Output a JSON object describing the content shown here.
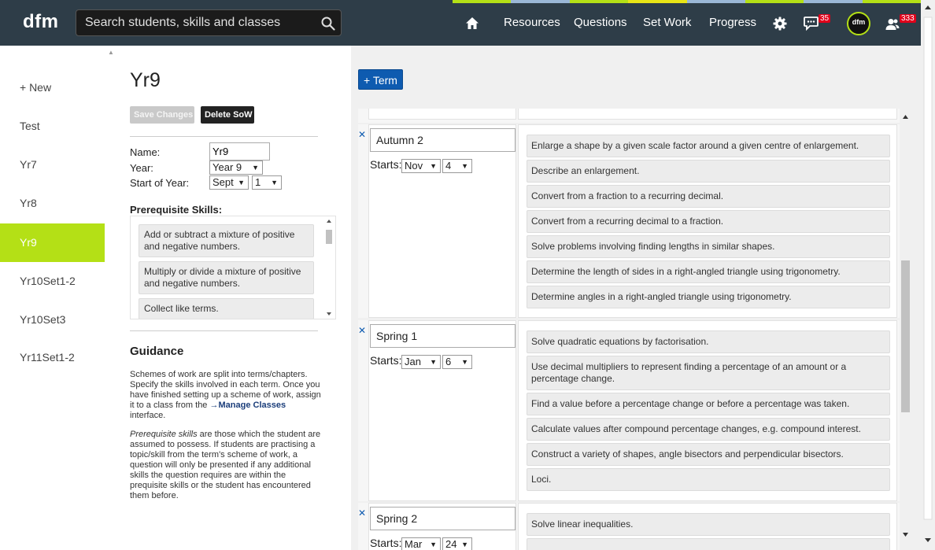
{
  "header": {
    "logo": "dfm",
    "search_placeholder": "Search students, skills and classes",
    "nav": [
      "Resources",
      "Questions",
      "Set Work",
      "Progress"
    ],
    "messages_badge": "35",
    "notifications_badge": "333",
    "avatar_text": "dfm",
    "strip_colors": [
      "#b4e016",
      "#9ab7d6",
      "#b4e016",
      "#e8e516",
      "#9ab7d6",
      "#b4e016",
      "#9ab7d6",
      "#b4e016"
    ]
  },
  "sidebar": {
    "items": [
      "+ New",
      "Test",
      "Yr7",
      "Yr8",
      "Yr9",
      "Yr10Set1-2",
      "Yr10Set3",
      "Yr11Set1-2"
    ],
    "active_index": 4
  },
  "sow": {
    "title": "Yr9",
    "save_label": "Save Changes",
    "delete_label": "Delete SoW",
    "name_label": "Name:",
    "name_value": "Yr9",
    "year_label": "Year:",
    "year_value": "Year 9",
    "start_label": "Start of Year:",
    "start_month": "Sept",
    "start_day": "1",
    "prereq_label": "Prerequisite Skills:",
    "prereq_items": [
      "Add or subtract a mixture of positive and negative numbers.",
      "Multiply or divide a mixture of positive and negative numbers.",
      "Collect like terms."
    ]
  },
  "guidance": {
    "title": "Guidance",
    "p1_before": "Schemes of work are split into terms/chapters. Specify the skills involved in each term. Once you have finished setting up a scheme of work, assign it to a class from the ",
    "p1_link": "→Manage Classes",
    "p1_after": " interface.",
    "p2_em": "Prerequisite skills",
    "p2_rest": " are those which the student are assumed to possess. If students are practising a topic/skill from the term's scheme of work, a question will only be presented if any additional skills the question requires are within the prequisite skills or the student has encountered them before."
  },
  "terms_panel": {
    "add_term_label": "+ Term",
    "starts_label": "Starts:",
    "terms": [
      {
        "name": "Autumn 2",
        "month": "Nov",
        "day": "4",
        "skills": [
          "Enlarge a shape by a given scale factor around a given centre of enlargement.",
          "Describe an enlargement.",
          "Convert from a fraction to a recurring decimal.",
          "Convert from a recurring decimal to a fraction.",
          "Solve problems involving finding lengths in similar shapes.",
          "Determine the length of sides in a right-angled triangle using trigonometry.",
          "Determine angles in a right-angled triangle using trigonometry."
        ]
      },
      {
        "name": "Spring 1",
        "month": "Jan",
        "day": "6",
        "skills": [
          "Solve quadratic equations by factorisation.",
          "Use decimal multipliers to represent finding a percentage of an amount or a percentage change.",
          "Find a value before a percentage change or before a percentage was taken.",
          "Calculate values after compound percentage changes, e.g. compound interest.",
          "Construct a variety of shapes, angle bisectors and perpendicular bisectors.",
          "Loci."
        ]
      },
      {
        "name": "Spring 2",
        "month": "Mar",
        "day": "24",
        "skills": [
          "Solve linear inequalities."
        ]
      }
    ]
  }
}
